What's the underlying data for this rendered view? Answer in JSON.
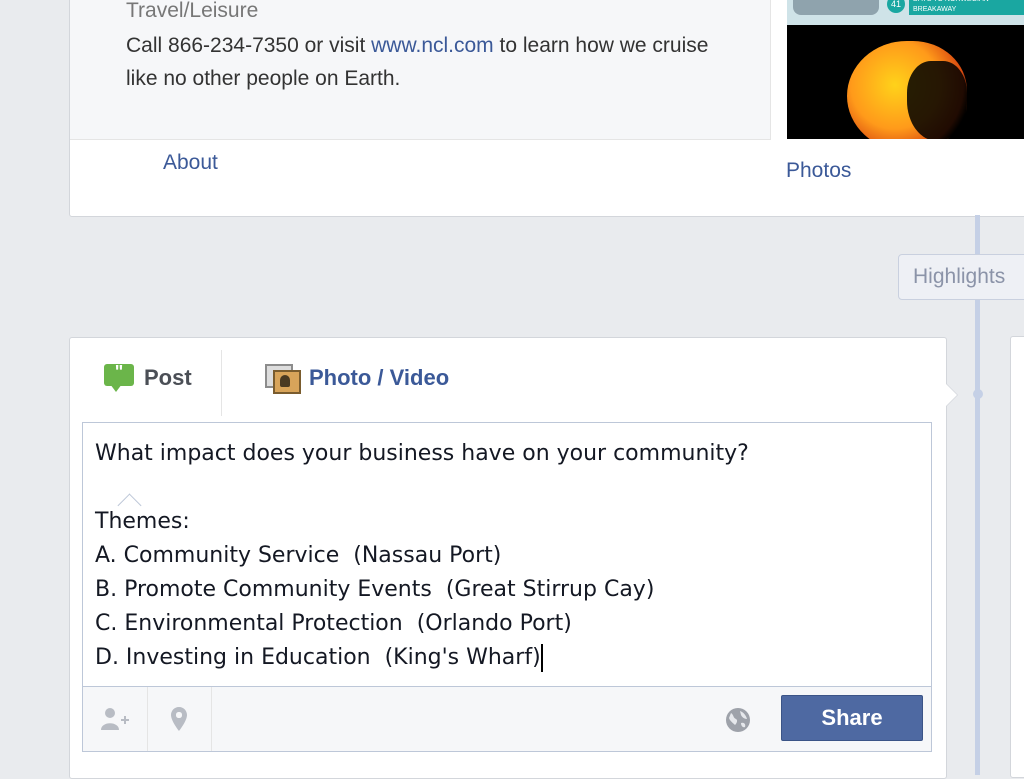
{
  "about": {
    "category": "Travel/Leisure",
    "description_pre": "Call 866-234-7350 or visit ",
    "link": "www.ncl.com",
    "description_post": " to learn how we cruise like no other people on Earth.",
    "about_link": "About"
  },
  "photos": {
    "label": "Photos",
    "banner_badge": "41",
    "banner_text": "DAYS TO NORWEGIAN BREAKAWAY"
  },
  "timeline": {
    "highlights_label": "Highlights"
  },
  "composer": {
    "tabs": [
      {
        "label": "Post",
        "active": true
      },
      {
        "label": "Photo / Video",
        "active": false
      }
    ],
    "post_text": "What impact does your business have on your community?\n\nThemes:\nA. Community Service  (Nassau Port)\nB. Promote Community Events  (Great Stirrup Cay)\nC. Environmental Protection  (Orlando Port)\nD. Investing in Education  (King's Wharf)",
    "share_label": "Share",
    "icons": [
      "tag-people-icon",
      "location-icon",
      "audience-globe-icon"
    ]
  },
  "colors": {
    "brand_blue": "#3b5998",
    "share_button": "#4e69a2",
    "status_green": "#6bb54a",
    "timeline_line": "#c5d0e6"
  }
}
